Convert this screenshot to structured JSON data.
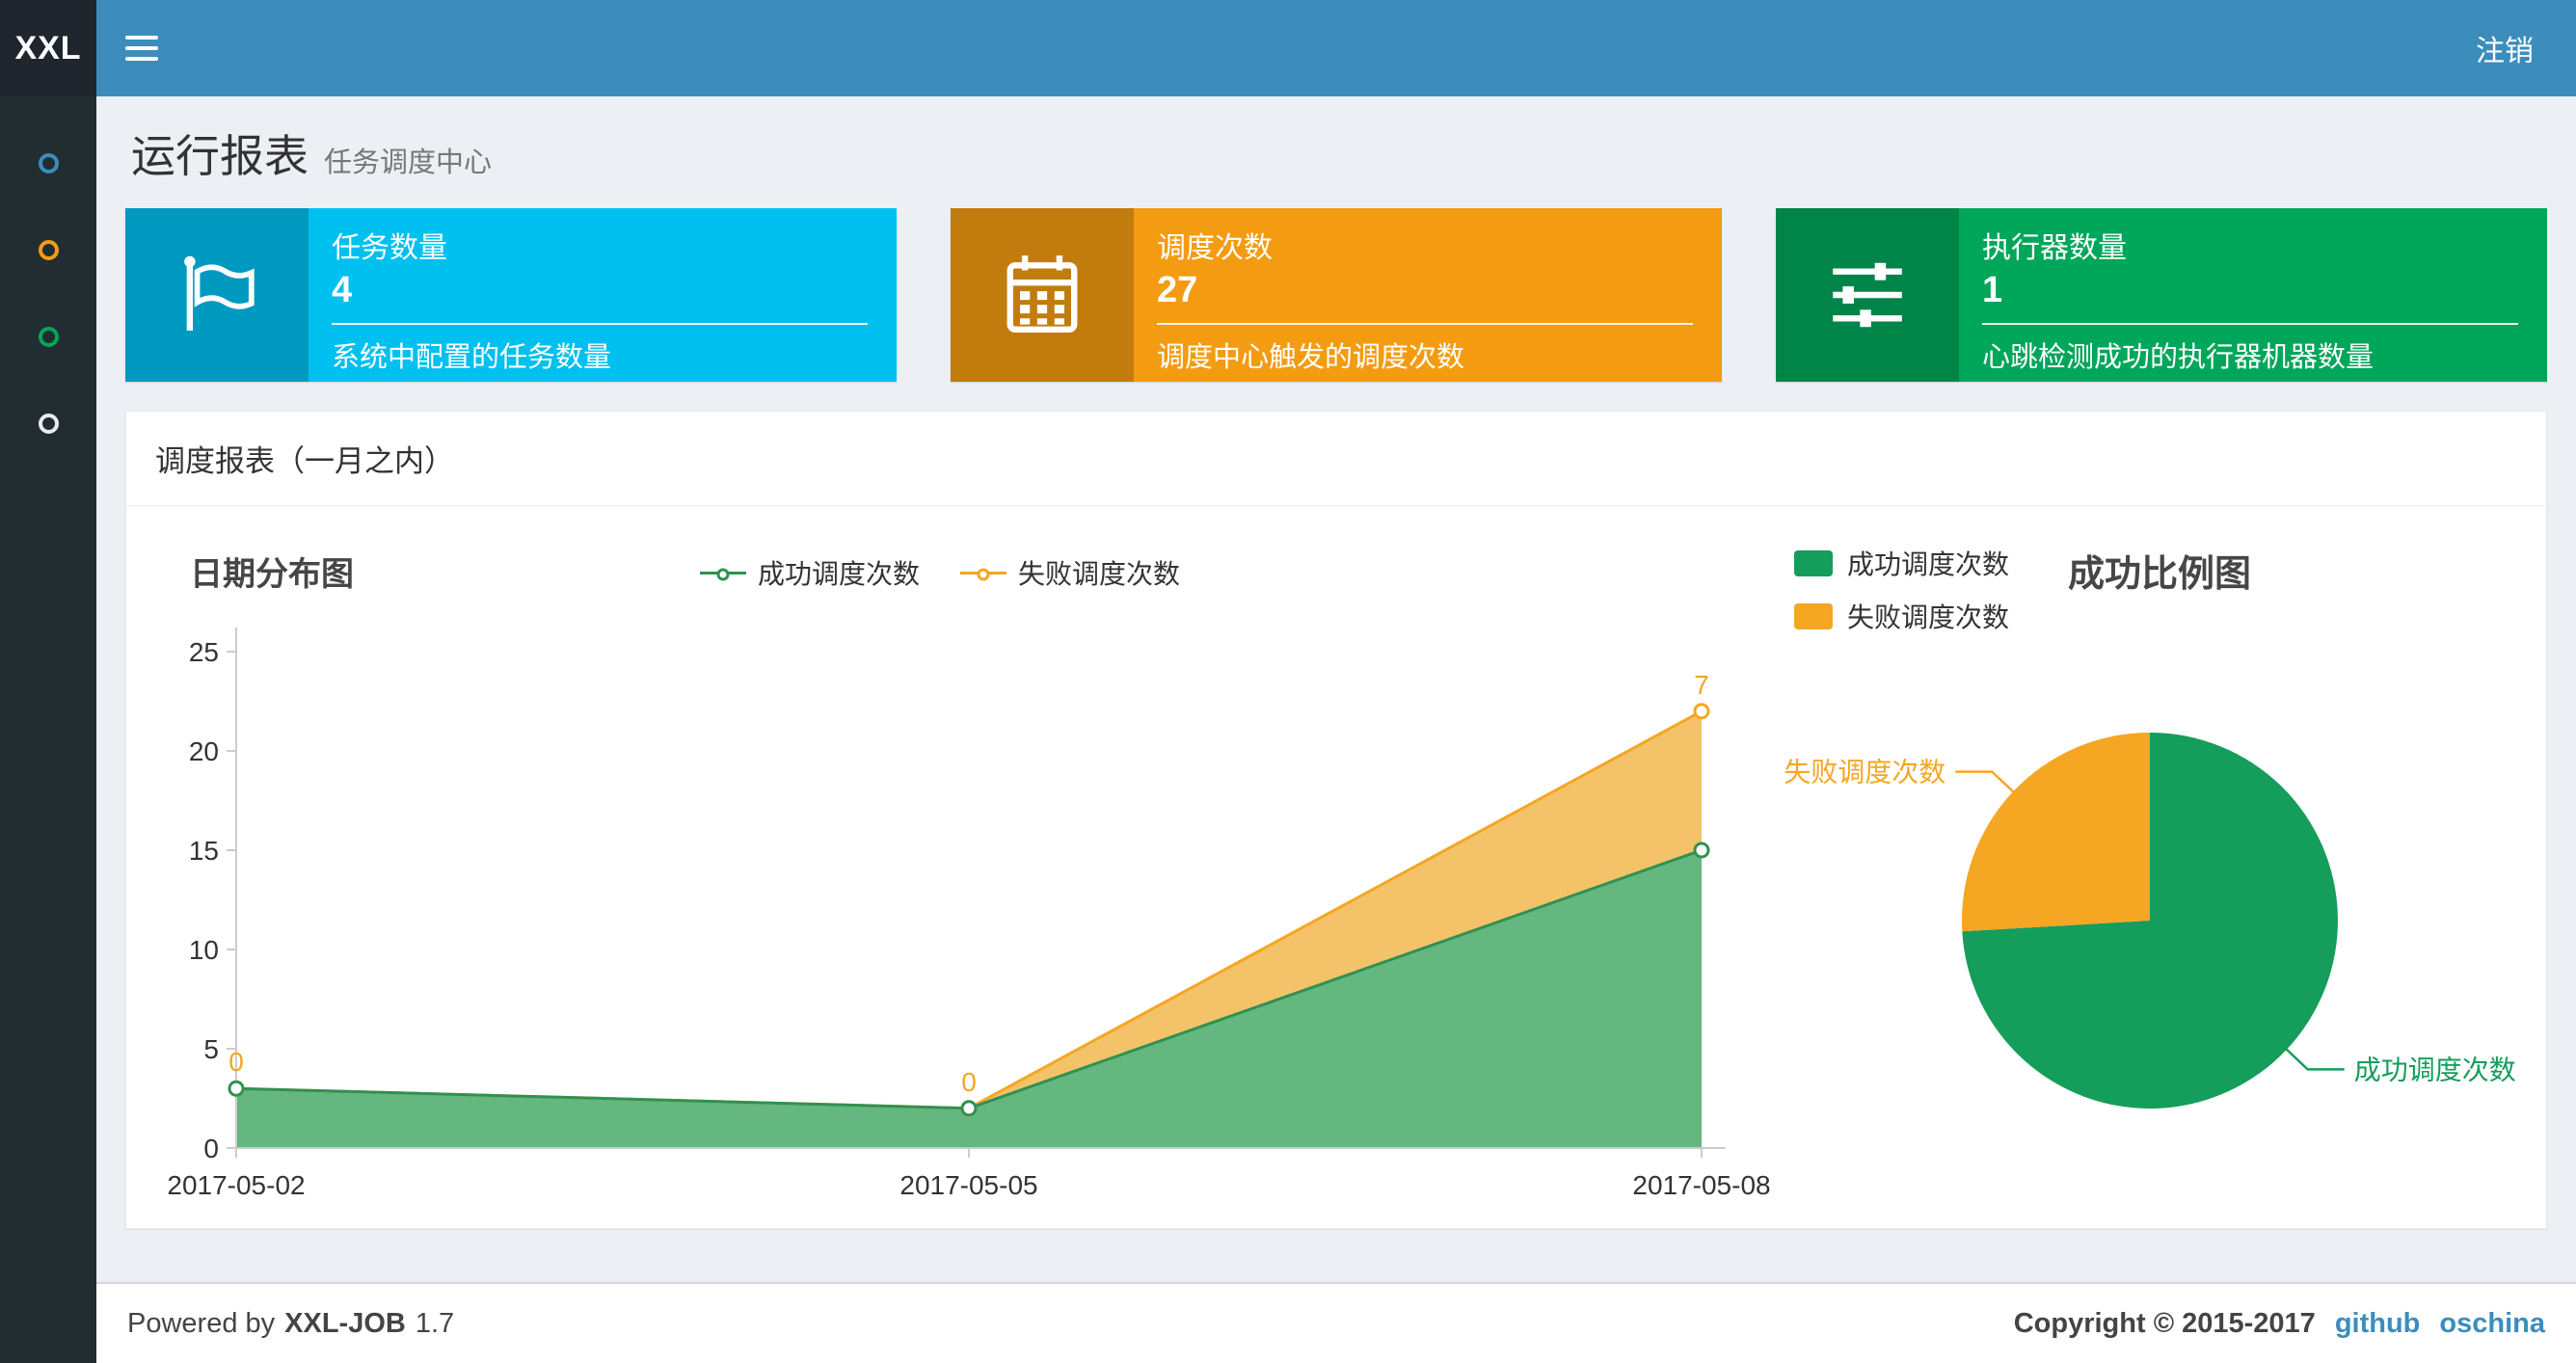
{
  "navbar": {
    "logo": "XXL",
    "logout_label": "注销"
  },
  "sidebar": {
    "items": [
      {
        "name": "run-report",
        "color": "#3c8dbc"
      },
      {
        "name": "job-manage",
        "color": "#f39c12"
      },
      {
        "name": "dispatch-log",
        "color": "#00a65a"
      },
      {
        "name": "help",
        "color": "#e8ecef"
      }
    ]
  },
  "page": {
    "title": "运行报表",
    "subtitle": "任务调度中心"
  },
  "info_boxes": [
    {
      "icon": "flag-icon",
      "label": "任务数量",
      "value": "4",
      "desc": "系统中配置的任务数量",
      "color": "#00c0ef"
    },
    {
      "icon": "calendar-icon",
      "label": "调度次数",
      "value": "27",
      "desc": "调度中心触发的调度次数",
      "color": "#f39c12"
    },
    {
      "icon": "sliders-icon",
      "label": "执行器数量",
      "value": "1",
      "desc": "心跳检测成功的执行器机器数量",
      "color": "#00a65a"
    }
  ],
  "panel": {
    "title": "调度报表（一月之内）"
  },
  "chart_data": [
    {
      "type": "area",
      "title": "日期分布图",
      "x": [
        "2017-05-02",
        "2017-05-05",
        "2017-05-08"
      ],
      "stacked": true,
      "series": [
        {
          "name": "成功调度次数",
          "values": [
            3,
            2,
            15
          ],
          "line_color": "#2f9152",
          "fill_color": "#5cb377"
        },
        {
          "name": "失败调度次数",
          "values": [
            0,
            0,
            7
          ],
          "line_color": "#f5a623",
          "fill_color": "#f2bb54",
          "point_labels": [
            "0",
            "0",
            "7"
          ]
        }
      ],
      "ylim": [
        0,
        25
      ],
      "yticks": [
        0,
        5,
        10,
        15,
        20,
        25
      ],
      "legend_position": "top-center",
      "grid": false
    },
    {
      "type": "pie",
      "title": "成功比例图",
      "slices": [
        {
          "name": "成功调度次数",
          "value": 20,
          "color": "#149d5b"
        },
        {
          "name": "失败调度次数",
          "value": 7,
          "color": "#f5a623"
        }
      ],
      "legend_position": "top-left"
    }
  ],
  "footer": {
    "powered_prefix": "Powered by",
    "brand": "XXL-JOB",
    "version": "1.7",
    "copyright": "Copyright © 2015-2017",
    "links": [
      {
        "label": "github"
      },
      {
        "label": "oschina"
      }
    ]
  }
}
